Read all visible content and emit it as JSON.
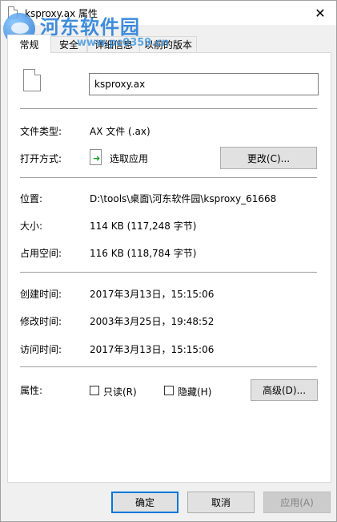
{
  "window": {
    "title": "ksproxy.ax 属性",
    "close_glyph": "✕"
  },
  "watermark": {
    "title": "河东软件园",
    "url": "www.pc0359.cn"
  },
  "tabs": [
    {
      "label": "常规"
    },
    {
      "label": "安全"
    },
    {
      "label": "详细信息"
    },
    {
      "label": "以前的版本"
    }
  ],
  "general": {
    "file_name": "ksproxy.ax",
    "file_type_label": "文件类型:",
    "file_type_value": "AX 文件 (.ax)",
    "open_with_label": "打开方式:",
    "open_with_value": "选取应用",
    "change_button": "更改(C)...",
    "location_label": "位置:",
    "location_value": "D:\\tools\\桌面\\河东软件园\\ksproxy_61668",
    "size_label": "大小:",
    "size_value": "114 KB (117,248 字节)",
    "size_on_disk_label": "占用空间:",
    "size_on_disk_value": "116 KB (118,784 字节)",
    "created_label": "创建时间:",
    "created_value": "2017年3月13日，15:15:06",
    "modified_label": "修改时间:",
    "modified_value": "2003年3月25日，19:48:52",
    "accessed_label": "访问时间:",
    "accessed_value": "2017年3月13日，15:15:06",
    "attributes_label": "属性:",
    "readonly_label": "只读(R)",
    "readonly_checked": false,
    "hidden_label": "隐藏(H)",
    "hidden_checked": false,
    "advanced_button": "高级(D)..."
  },
  "footer": {
    "ok_button": "确定",
    "cancel_button": "取消",
    "apply_button": "应用(A)",
    "apply_enabled": false
  },
  "colors": {
    "accent": "#0078d7",
    "watermark": "#1d79d8",
    "open_with_arrow": "#1e9e2d"
  },
  "icons": {
    "title_icon": "file-icon",
    "file_icon": "file-icon",
    "open_with_icon": "open-with-app-icon",
    "close_icon": "close-icon"
  }
}
